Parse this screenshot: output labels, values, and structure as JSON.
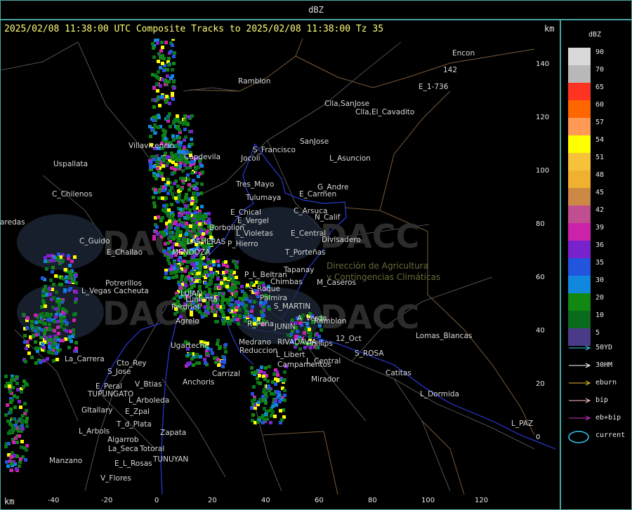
{
  "title": "dBZ",
  "header": "2025/02/08 11:38:00 UTC Composite Tracks to 2025/02/08 11:38:00 Tz 35",
  "unit_top": "km",
  "unit_bottom": "km",
  "legend": {
    "title": "dBZ",
    "levels": [
      {
        "label": "90",
        "color": "#d9d9d9"
      },
      {
        "label": "70",
        "color": "#b8b8b8"
      },
      {
        "label": "65",
        "color": "#ff3322"
      },
      {
        "label": "60",
        "color": "#ff6600"
      },
      {
        "label": "57",
        "color": "#ff9955"
      },
      {
        "label": "54",
        "color": "#ffff00"
      },
      {
        "label": "51",
        "color": "#f5c23a"
      },
      {
        "label": "48",
        "color": "#f0b030"
      },
      {
        "label": "45",
        "color": "#cc8844"
      },
      {
        "label": "42",
        "color": "#c04e90"
      },
      {
        "label": "39",
        "color": "#cc22aa"
      },
      {
        "label": "36",
        "color": "#7722cc"
      },
      {
        "label": "35",
        "color": "#2255dd"
      },
      {
        "label": "30",
        "color": "#1188dd"
      },
      {
        "label": "20",
        "color": "#118811"
      },
      {
        "label": "10",
        "color": "#0a6a1e"
      },
      {
        "label": "5",
        "color": "#4a3a88"
      }
    ],
    "tracks": [
      {
        "label": "50YD",
        "color": "#33ccee"
      },
      {
        "label": "30HM",
        "color": "#ffffff"
      },
      {
        "label": "eburn",
        "color": "#e8b830"
      },
      {
        "label": "bip",
        "color": "#ffc0c8"
      },
      {
        "label": "eb+bip",
        "color": "#cc33cc"
      },
      {
        "label": "current",
        "color": "#33ccee"
      }
    ]
  },
  "x_ticks": [
    "-40",
    "-20",
    "0",
    "20",
    "40",
    "60",
    "80",
    "100",
    "120"
  ],
  "y_ticks": [
    "140",
    "120",
    "100",
    "80",
    "60",
    "40",
    "20",
    "0"
  ],
  "watermark": "DACC",
  "places": [
    {
      "name": "Ramblon"
    },
    {
      "name": "Encon"
    },
    {
      "name": "E_1-736"
    },
    {
      "name": "142"
    },
    {
      "name": "Clla,SanJose"
    },
    {
      "name": "Clla,El_Cavadito"
    },
    {
      "name": "S_Francisco"
    },
    {
      "name": "SanJose"
    },
    {
      "name": "Jocoli"
    },
    {
      "name": "L_Asuncion"
    },
    {
      "name": "Villavicencio"
    },
    {
      "name": "Capdevila"
    },
    {
      "name": "Uspallata"
    },
    {
      "name": "Tres_Mayo"
    },
    {
      "name": "G_Andre"
    },
    {
      "name": "Tulumaya"
    },
    {
      "name": "E_Carmen"
    },
    {
      "name": "C_Chilenos"
    },
    {
      "name": "E_Chical"
    },
    {
      "name": "C_Arsuca"
    },
    {
      "name": "E_Vergel"
    },
    {
      "name": "N_Calif"
    },
    {
      "name": "aredas"
    },
    {
      "name": "Borbollon"
    },
    {
      "name": "L_Violetas"
    },
    {
      "name": "E_Central"
    },
    {
      "name": "C_Guido"
    },
    {
      "name": "LASHERAS"
    },
    {
      "name": "P_Hierro"
    },
    {
      "name": "Divisadero"
    },
    {
      "name": "MENDOZA"
    },
    {
      "name": "E_Challao"
    },
    {
      "name": "T_Porteñas"
    },
    {
      "name": "Tapanay"
    },
    {
      "name": "P_L_Beltran"
    },
    {
      "name": "Potrerillos"
    },
    {
      "name": "Chimbas"
    },
    {
      "name": "M_Caseros"
    },
    {
      "name": "L_Vegas"
    },
    {
      "name": "Cacheuta"
    },
    {
      "name": "S_Roque"
    },
    {
      "name": "LUJAN"
    },
    {
      "name": "Palmira"
    },
    {
      "name": "Lunlunta"
    },
    {
      "name": "S_MARTIN"
    },
    {
      "name": "Perdriel"
    },
    {
      "name": "Agrelo"
    },
    {
      "name": "A_Verde"
    },
    {
      "name": "Ramblon"
    },
    {
      "name": "R_Peña"
    },
    {
      "name": "JUNIN"
    },
    {
      "name": "12_Oct"
    },
    {
      "name": "Lomas_Blancas"
    },
    {
      "name": "Medrano"
    },
    {
      "name": "RIVADAVIA"
    },
    {
      "name": "Phillips"
    },
    {
      "name": "Ugarteche"
    },
    {
      "name": "Reduccion"
    },
    {
      "name": "L_Libert"
    },
    {
      "name": "S_ROSA"
    },
    {
      "name": "La_Carrera"
    },
    {
      "name": "Cto_Rey"
    },
    {
      "name": "L_Central"
    },
    {
      "name": "Campamentos"
    },
    {
      "name": "S_Jose"
    },
    {
      "name": "Carrizal"
    },
    {
      "name": "Catitas"
    },
    {
      "name": "Mirador"
    },
    {
      "name": "E_Peral"
    },
    {
      "name": "V_Btias"
    },
    {
      "name": "Anchoris"
    },
    {
      "name": "TUPUNGATO"
    },
    {
      "name": "L_Dormida"
    },
    {
      "name": "L_Arboleda"
    },
    {
      "name": "Gltallary"
    },
    {
      "name": "E_Zpal"
    },
    {
      "name": "L_PAZ"
    },
    {
      "name": "T_d_Plata"
    },
    {
      "name": "L_Arbols"
    },
    {
      "name": "Zapata"
    },
    {
      "name": "Algarrob"
    },
    {
      "name": "La_Seca"
    },
    {
      "name": "Totoral"
    },
    {
      "name": "Manzano"
    },
    {
      "name": "E_L_Rosas"
    },
    {
      "name": "TUNUYAN"
    },
    {
      "name": "V_Flores"
    },
    {
      "name": "Dirección de Agricultura"
    },
    {
      "name": "y Contingencias Climáticas"
    }
  ]
}
